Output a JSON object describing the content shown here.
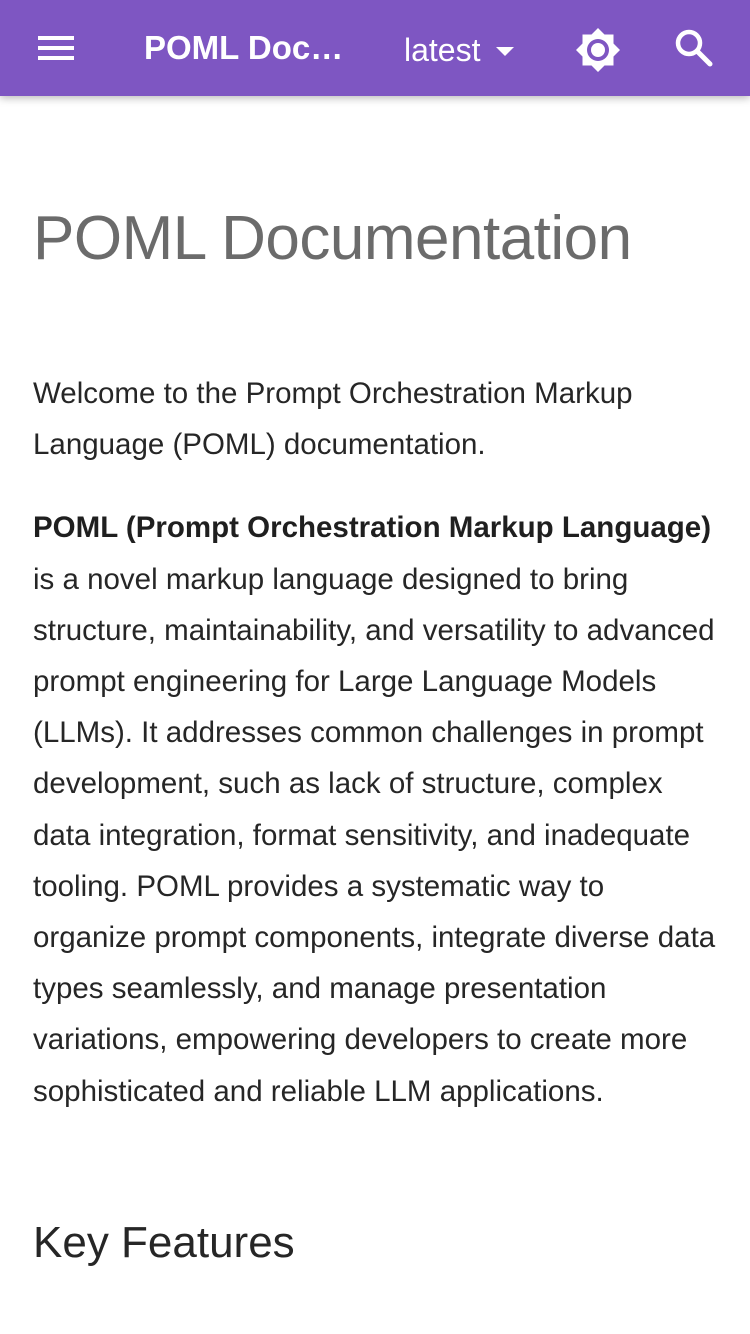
{
  "header": {
    "menu_icon": "hamburger-menu-icon",
    "title": "POML Documentation",
    "version": "latest",
    "theme_icon": "brightness-toggle-icon",
    "search_icon": "search-icon",
    "bar_color": "#7e56c2"
  },
  "main": {
    "title": "POML Documentation",
    "intro": "Welcome to the Prompt Orchestration Markup Language (POML) documentation.",
    "description_bold": "POML (Prompt Orchestration Markup Language)",
    "description_rest": " is a novel markup language designed to bring structure, maintainability, and versatility to advanced prompt engineering for Large Language Models (LLMs). It addresses common challenges in prompt development, such as lack of structure, complex data integration, format sensitivity, and inadequate tooling. POML provides a systematic way to organize prompt components, integrate diverse data types seamlessly, and manage presentation variations, empowering developers to create more sophisticated and reliable LLM applications.",
    "section_heading": "Key Features"
  }
}
